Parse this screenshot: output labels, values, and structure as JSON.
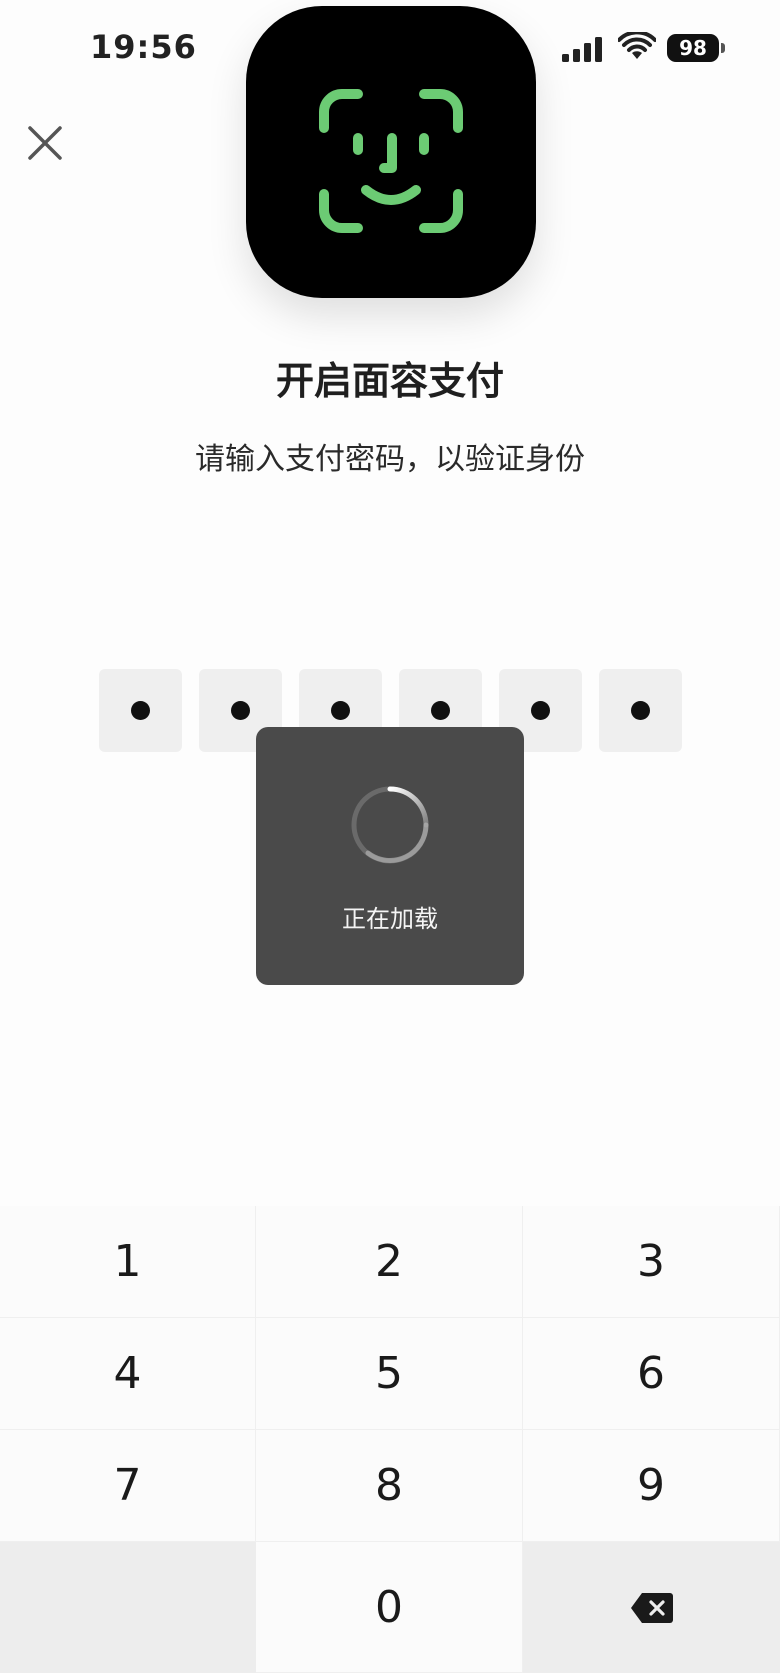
{
  "status_bar": {
    "time": "19:56",
    "battery": "98"
  },
  "dialog": {
    "title": "开启面容支付",
    "subtitle": "请输入支付密码，以验证身份"
  },
  "pin": {
    "length": 6,
    "filled": 6
  },
  "toast": {
    "label": "正在加载"
  },
  "keypad": {
    "keys": [
      "1",
      "2",
      "3",
      "4",
      "5",
      "6",
      "7",
      "8",
      "9",
      "",
      "0",
      "delete"
    ]
  },
  "icons": {
    "close": "close-icon",
    "app": "face-id-icon",
    "delete": "backspace-icon",
    "signal": "cellular-signal-icon",
    "wifi": "wifi-icon"
  },
  "colors": {
    "face_id_green": "#6ccb74",
    "toast_bg": "#4a4a4a",
    "pin_box": "#efefef"
  }
}
